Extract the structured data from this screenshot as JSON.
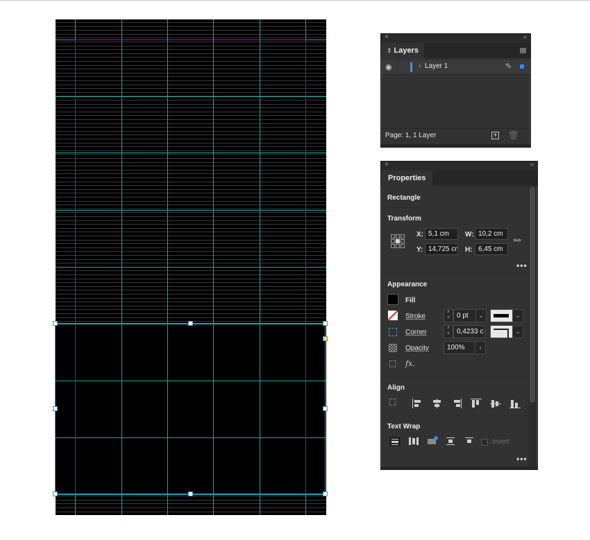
{
  "canvas": {
    "selected_object": "Rectangle",
    "guide_color": "#1fa5a8",
    "margin_color": "#a0307a",
    "selection_color": "#3c8ed8"
  },
  "layers_panel": {
    "close_icon": "×",
    "collapse_icon": "‹‹",
    "tab_label": "Layers",
    "tab_icon": "⇕",
    "layers": [
      {
        "name": "Layer 1",
        "visible": true,
        "color": "#4f8fe0",
        "expanded": false
      }
    ],
    "status": "Page: 1, 1 Layer",
    "new_layer_icon": "+",
    "delete_icon": "🗑"
  },
  "properties_panel": {
    "close_icon": "×",
    "collapse_icon": "‹‹",
    "tab_label": "Properties",
    "object_type": "Rectangle",
    "transform": {
      "title": "Transform",
      "x_label": "X:",
      "x_value": "5,1 cm",
      "y_label": "Y:",
      "y_value": "14,725 cr",
      "w_label": "W:",
      "w_value": "10,2 cm",
      "h_label": "H:",
      "h_value": "6,45 cm",
      "more": "•••"
    },
    "appearance": {
      "title": "Appearance",
      "fill_label": "Fill",
      "fill_color": "#000000",
      "stroke_label": "Stroke",
      "stroke_weight": "0 pt",
      "corner_label": "Corner",
      "corner_value": "0,4233 c",
      "opacity_label": "Opacity",
      "opacity_value": "100%",
      "fx_label": "fx."
    },
    "align": {
      "title": "Align"
    },
    "text_wrap": {
      "title": "Text Wrap",
      "invert_label": "Invert",
      "invert_checked": false,
      "more": "•••"
    }
  }
}
